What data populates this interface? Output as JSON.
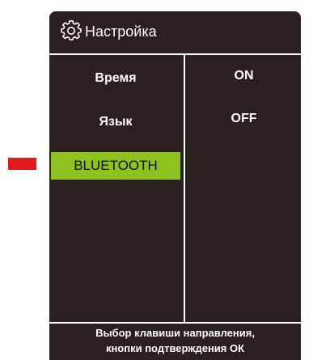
{
  "header": {
    "title": "Настройка",
    "icon": "gear-icon"
  },
  "menu": {
    "items": [
      {
        "label": "Время",
        "selected": false
      },
      {
        "label": "Язык",
        "selected": false
      },
      {
        "label": "BLUETOOTH",
        "selected": true
      }
    ],
    "selected_color": "#8dc21f"
  },
  "options": {
    "items": [
      {
        "label": "ON"
      },
      {
        "label": "OFF"
      }
    ]
  },
  "footer": {
    "line1": "Выбор клавиши направления,",
    "line2": "кнопки подтверждения ОК"
  },
  "colors": {
    "panel_background": "#2a211f",
    "marker": "#e3191c",
    "text": "#ffffff"
  }
}
